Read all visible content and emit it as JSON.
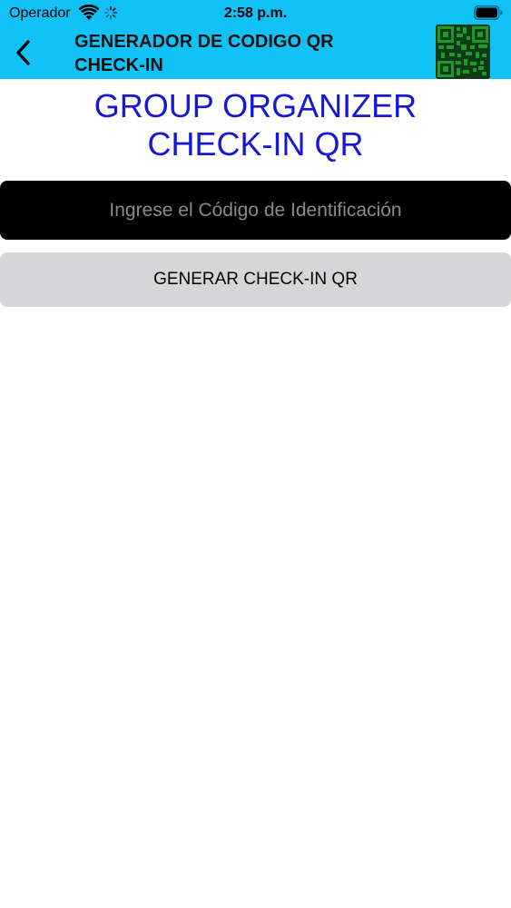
{
  "status_bar": {
    "carrier": "Operador",
    "time": "2:58 p.m.",
    "icons": [
      "wifi-icon",
      "activity-spinner-icon",
      "battery-icon"
    ]
  },
  "nav_bar": {
    "back_icon": "chevron-left-icon",
    "title_line1": "GENERADOR DE CODIGO QR",
    "title_line2": "CHECK-IN",
    "qr_icon": "qr-code-icon"
  },
  "main": {
    "title_line1": "GROUP ORGANIZER",
    "title_line2": "CHECK-IN QR",
    "id_input": {
      "value": "",
      "placeholder": "Ingrese el Código de Identificación"
    },
    "generate_button_label": "GENERAR CHECK-IN QR"
  },
  "colors": {
    "header_background": "#12c1f5",
    "title_text": "#1717d6",
    "input_background": "#000000",
    "button_background": "#d6d6d8",
    "qr_dark": "#000000",
    "qr_light": "#1e9a2a"
  }
}
